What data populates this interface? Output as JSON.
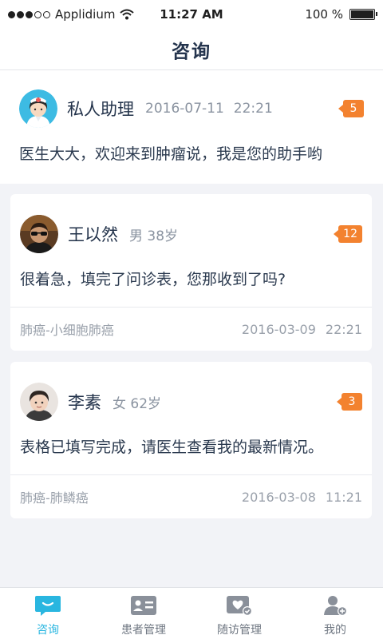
{
  "status_bar": {
    "carrier": "Applidium",
    "time": "11:27 AM",
    "battery": "100 %",
    "battery_level": 1.0
  },
  "nav": {
    "title": "咨询"
  },
  "assistant": {
    "name": "私人助理",
    "date": "2016-07-11",
    "time": "22:21",
    "badge": "5",
    "message": "医生大大，欢迎来到肿瘤说，我是您的助手哟"
  },
  "consults": [
    {
      "name": "王以然",
      "info": "男 38岁",
      "badge": "12",
      "message": "很着急，填完了问诊表，您那收到了吗?",
      "diagnosis": "肺癌-小细胞肺癌",
      "date": "2016-03-09",
      "time": "22:21"
    },
    {
      "name": "李素",
      "info": "女 62岁",
      "badge": "3",
      "message": "表格已填写完成，请医生查看我的最新情况。",
      "diagnosis": "肺癌-肺鳞癌",
      "date": "2016-03-08",
      "time": "11:21"
    }
  ],
  "tabs": [
    {
      "label": "咨询",
      "icon": "chat-icon",
      "active": true
    },
    {
      "label": "患者管理",
      "icon": "patient-card-icon",
      "active": false
    },
    {
      "label": "随访管理",
      "icon": "heart-check-icon",
      "active": false
    },
    {
      "label": "我的",
      "icon": "user-add-icon",
      "active": false
    }
  ],
  "colors": {
    "accent": "#29b6e0",
    "badge": "#f3822f",
    "title": "#24344d"
  }
}
